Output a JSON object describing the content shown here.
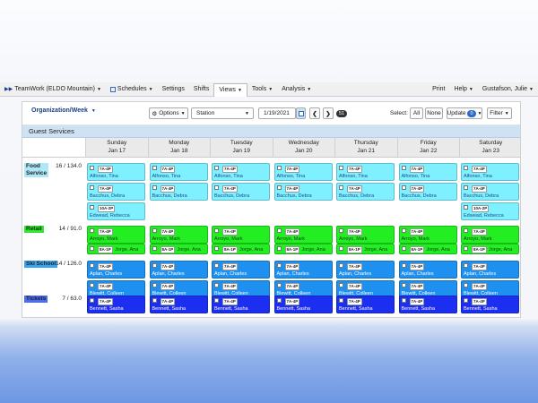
{
  "nav": {
    "app": "TeamWork (ELDO Mountain)",
    "schedules": "Schedules",
    "settings": "Settings",
    "shifts": "Shifts",
    "views": "Views",
    "tools": "Tools",
    "analysis": "Analysis",
    "print": "Print",
    "help": "Help",
    "user": "Gustafson, Julie"
  },
  "toolbar": {
    "org_week": "Organization/Week",
    "options": "Options",
    "station": "Station",
    "date": "1/19/2021",
    "badge": "51",
    "select_label": "Select:",
    "all": "All",
    "none": "None",
    "update": "Update",
    "update_count": "0",
    "filter": "Filter"
  },
  "location": "Guest Services",
  "days": [
    {
      "dow": "Sunday",
      "date": "Jan 17"
    },
    {
      "dow": "Monday",
      "date": "Jan 18"
    },
    {
      "dow": "Tuesday",
      "date": "Jan 19"
    },
    {
      "dow": "Wednesday",
      "date": "Jan 20"
    },
    {
      "dow": "Thursday",
      "date": "Jan 21"
    },
    {
      "dow": "Friday",
      "date": "Jan 22"
    },
    {
      "dow": "Saturday",
      "date": "Jan 23"
    }
  ],
  "stations": [
    {
      "name": "Food Service",
      "name_lines": [
        "Food",
        "Service"
      ],
      "count": "16 / 134.0",
      "label_bg": "#aee7f7",
      "color": "#7ff0ff",
      "text_color": "#1a4a8a",
      "layout": "vertical",
      "cells": [
        [
          {
            "time": "7A-4P",
            "name": "Alfonso, Tina"
          },
          {
            "time": "7A-4P",
            "name": "Bacchus, Debra"
          },
          {
            "time": "10A-2P",
            "name": "Edwead, Rebecca"
          }
        ],
        [
          {
            "time": "7A-4P",
            "name": "Alfonso, Tina"
          },
          {
            "time": "7A-4P",
            "name": "Bacchus, Debra"
          }
        ],
        [
          {
            "time": "7A-4P",
            "name": "Alfonso, Tina"
          },
          {
            "time": "7A-4P",
            "name": "Bacchus, Debra"
          }
        ],
        [
          {
            "time": "7A-4P",
            "name": "Alfonso, Tina"
          },
          {
            "time": "7A-4P",
            "name": "Bacchus, Debra"
          }
        ],
        [
          {
            "time": "7A-4P",
            "name": "Alfonso, Tina"
          },
          {
            "time": "7A-4P",
            "name": "Bacchus, Debra"
          }
        ],
        [
          {
            "time": "7A-4P",
            "name": "Alfonso, Tina"
          },
          {
            "time": "7A-4P",
            "name": "Bacchus, Debra"
          }
        ],
        [
          {
            "time": "7A-4P",
            "name": "Alfonso, Tina"
          },
          {
            "time": "7A-4P",
            "name": "Bacchus, Debra"
          },
          {
            "time": "10A-2P",
            "name": "Edwead, Rebecca"
          }
        ]
      ]
    },
    {
      "name": "Retail",
      "name_lines": [
        "Retail"
      ],
      "count": "14 / 91.0",
      "label_bg": "#2ee82e",
      "color": "#22ee22",
      "text_color": "#1a3a1a",
      "layout": "split",
      "cells": [
        [
          {
            "time": "7A-4P",
            "name": "Arroyo, Mark"
          },
          {
            "time": "8A-1P",
            "name": "Jorge, Ana"
          }
        ],
        [
          {
            "time": "7A-4P",
            "name": "Arroyo, Mark"
          },
          {
            "time": "8A-1P",
            "name": "Jorge, Ana"
          }
        ],
        [
          {
            "time": "7A-4P",
            "name": "Arroyo, Mark"
          },
          {
            "time": "8A-1P",
            "name": "Jorge, Ana"
          }
        ],
        [
          {
            "time": "7A-4P",
            "name": "Arroyo, Mark"
          },
          {
            "time": "8A-1P",
            "name": "Jorge, Ana"
          }
        ],
        [
          {
            "time": "7A-4P",
            "name": "Arroyo, Mark"
          },
          {
            "time": "8A-1P",
            "name": "Jorge, Ana"
          }
        ],
        [
          {
            "time": "7A-4P",
            "name": "Arroyo, Mark"
          },
          {
            "time": "8A-1P",
            "name": "Jorge, Ana"
          }
        ],
        [
          {
            "time": "7A-4P",
            "name": "Arroyo, Mark"
          },
          {
            "time": "8A-1P",
            "name": "Jorge, Ana"
          }
        ]
      ]
    },
    {
      "name": "Ski School",
      "name_lines": [
        "Ski School"
      ],
      "count": "14 / 126.0",
      "label_bg": "#3aa3f0",
      "color": "#1e90f0",
      "text_color": "#ffffff",
      "layout": "vertical",
      "cells": [
        [
          {
            "time": "7A-4P",
            "name": "Aplan, Charles"
          },
          {
            "time": "7A-4P",
            "name": "Blewitt, Colleen"
          }
        ],
        [
          {
            "time": "7A-4P",
            "name": "Aplan, Charles"
          },
          {
            "time": "7A-4P",
            "name": "Blewitt, Colleen"
          }
        ],
        [
          {
            "time": "7A-4P",
            "name": "Aplan, Charles"
          },
          {
            "time": "7A-4P",
            "name": "Blewitt, Colleen"
          }
        ],
        [
          {
            "time": "7A-4P",
            "name": "Aplan, Charles"
          },
          {
            "time": "7A-4P",
            "name": "Blewitt, Colleen"
          }
        ],
        [
          {
            "time": "7A-4P",
            "name": "Aplan, Charles"
          },
          {
            "time": "7A-4P",
            "name": "Blewitt, Colleen"
          }
        ],
        [
          {
            "time": "7A-4P",
            "name": "Aplan, Charles"
          },
          {
            "time": "7A-4P",
            "name": "Blewitt, Colleen"
          }
        ],
        [
          {
            "time": "7A-4P",
            "name": "Aplan, Charles"
          },
          {
            "time": "7A-4P",
            "name": "Blewitt, Colleen"
          }
        ]
      ]
    },
    {
      "name": "Tickets",
      "name_lines": [
        "Tickets"
      ],
      "count": "7 / 63.0",
      "label_bg": "#4a6cf0",
      "color": "#1c2ff0",
      "text_color": "#ffffff",
      "layout": "vertical",
      "cells": [
        [
          {
            "time": "7A-4P",
            "name": "Bennett, Sasha"
          }
        ],
        [
          {
            "time": "7A-4P",
            "name": "Bennett, Sasha"
          }
        ],
        [
          {
            "time": "7A-4P",
            "name": "Bennett, Sasha"
          }
        ],
        [
          {
            "time": "7A-4P",
            "name": "Bennett, Sasha"
          }
        ],
        [
          {
            "time": "7A-4P",
            "name": "Bennett, Sasha"
          }
        ],
        [
          {
            "time": "7A-4P",
            "name": "Bennett, Sasha"
          }
        ],
        [
          {
            "time": "7A-4P",
            "name": "Bennett, Sasha"
          }
        ]
      ]
    }
  ]
}
